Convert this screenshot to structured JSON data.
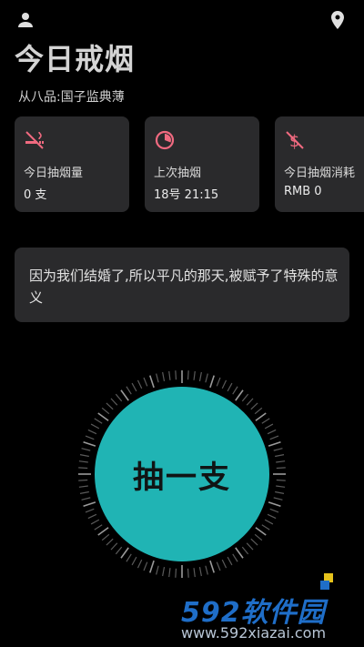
{
  "header": {
    "user_icon": "user-icon",
    "location_icon": "location-pin-icon",
    "title": "今日戒烟",
    "subtitle": "从八品:国子监典薄"
  },
  "stats": [
    {
      "icon": "no-smoking-icon",
      "label": "今日抽烟量",
      "value": "0 支"
    },
    {
      "icon": "timer-icon",
      "label": "上次抽烟",
      "value": "18号 21:15"
    },
    {
      "icon": "no-money-icon",
      "label": "今日抽烟消耗",
      "value": "RMB 0"
    }
  ],
  "quote": {
    "text": "因为我们结婚了,所以平凡的那天,被赋予了特殊的意义"
  },
  "smoke_button": {
    "label": "抽一支"
  },
  "watermark": {
    "brand": "592软件园",
    "url": "www.592xiazai.com"
  },
  "colors": {
    "background": "#000000",
    "card": "#2a2a2c",
    "accent_icon": "#f06a80",
    "button": "#20b4b4",
    "watermark_blue": "#1f6ec8"
  }
}
